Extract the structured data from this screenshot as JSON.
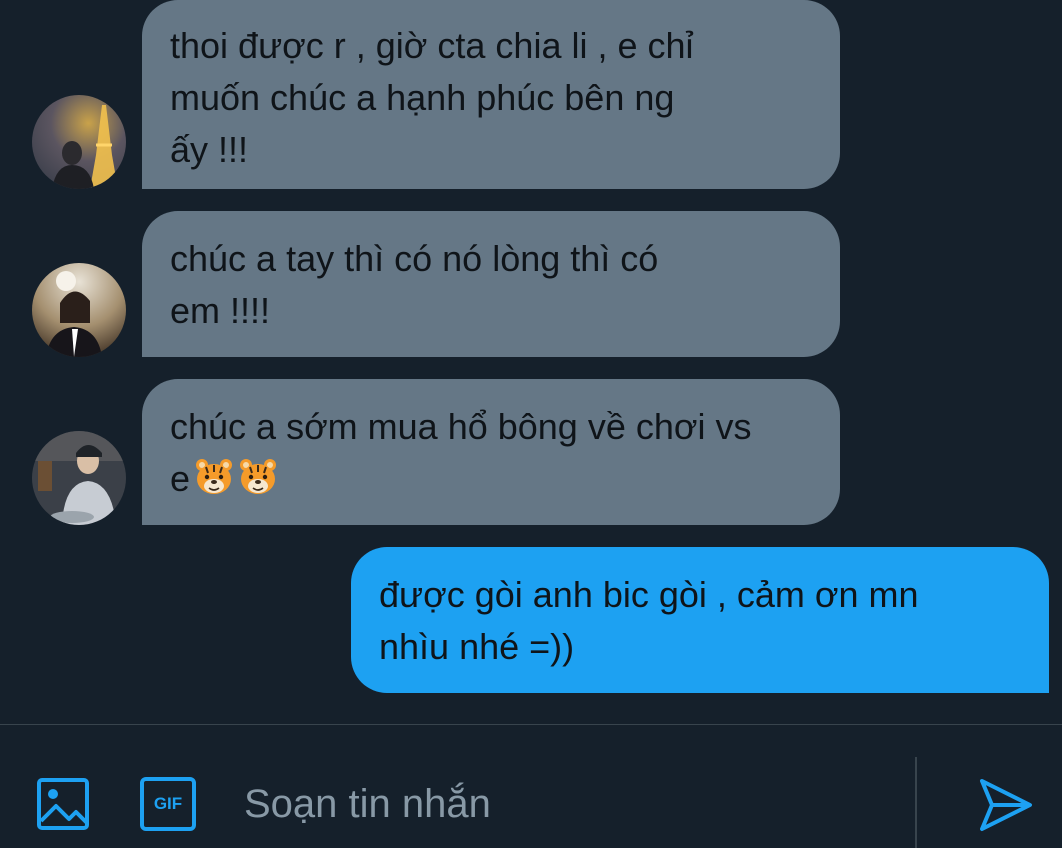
{
  "messages": [
    {
      "direction": "in",
      "avatar_icon": "avatar-eiffel-photo",
      "lines": [
        "thoi được r , giờ cta chia li , e chỉ",
        "muốn chúc a hạnh phúc bên ng",
        "ấy !!!"
      ]
    },
    {
      "direction": "in",
      "avatar_icon": "avatar-mirror-selfie",
      "lines": [
        "chúc a tay thì có nó lòng thì có",
        "em !!!!"
      ]
    },
    {
      "direction": "in",
      "avatar_icon": "avatar-restaurant-photo",
      "lines": [
        "chúc a sớm mua hổ bông về chơi vs",
        "e"
      ],
      "emojis": [
        "tiger-face",
        "tiger-face"
      ]
    },
    {
      "direction": "out",
      "lines": [
        "được gòi anh bic gòi , cảm ơn mn",
        "nhìu nhé =))"
      ]
    }
  ],
  "composer": {
    "placeholder": "Soạn tin nhắn",
    "gif_label": "GIF",
    "media_icon": "image-icon",
    "send_icon": "send-icon"
  },
  "colors": {
    "background": "#15202b",
    "incoming_bubble": "#657786",
    "outgoing_bubble": "#1da1f2",
    "accent": "#1da1f2",
    "placeholder": "#8899a6",
    "divider": "#38444d"
  }
}
